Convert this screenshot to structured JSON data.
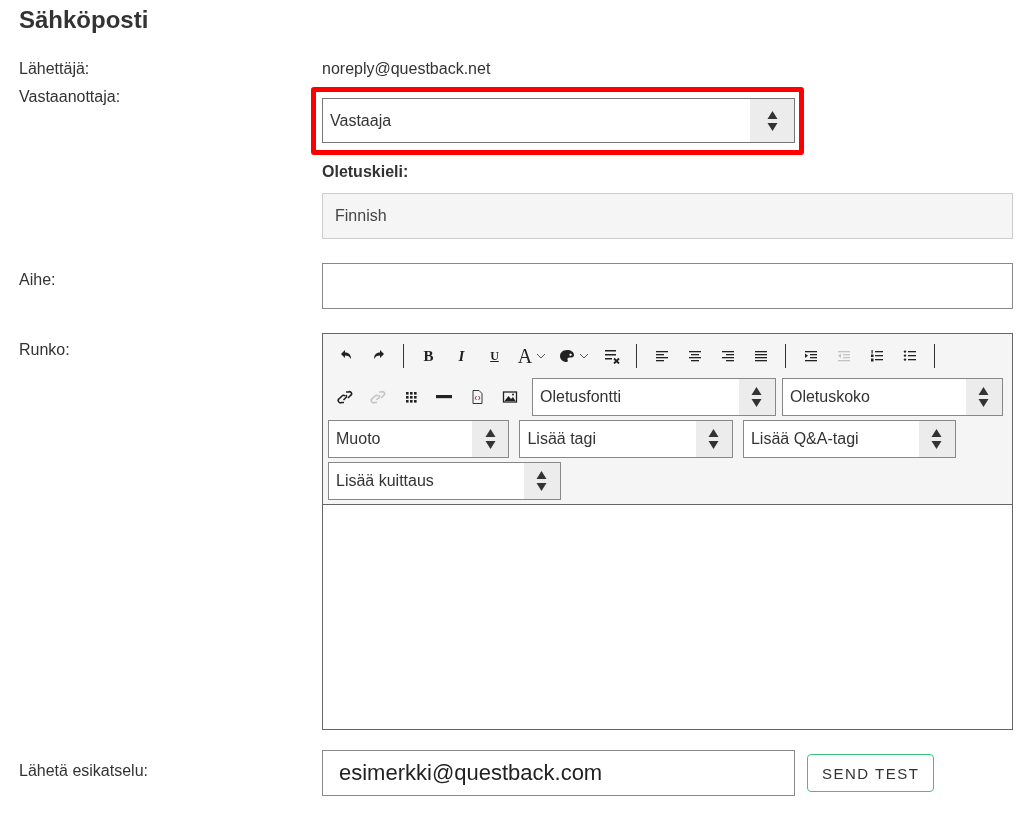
{
  "title": "Sähköposti",
  "sender": {
    "label": "Lähettäjä:",
    "value": "noreply@questback.net"
  },
  "recipient": {
    "label": "Vastaanottaja:",
    "value": "Vastaaja",
    "highlighted": true
  },
  "default_language": {
    "label": "Oletuskieli:",
    "value": "Finnish",
    "disabled": true
  },
  "subject": {
    "label": "Aihe:"
  },
  "body": {
    "label": "Runko:",
    "toolbar": [
      [
        {
          "kind": "undo",
          "disabled": false
        },
        {
          "kind": "redo",
          "disabled": false
        },
        {
          "kind": "separator"
        },
        {
          "kind": "text",
          "label": "B",
          "disabled": false
        },
        {
          "kind": "text",
          "label": "I",
          "disabled": false
        },
        {
          "kind": "text",
          "label": "U",
          "disabled": false
        },
        {
          "kind": "textcolor",
          "label": "A",
          "disabled": false
        },
        {
          "kind": "palette",
          "disabled": false
        },
        {
          "kind": "clearformat",
          "disabled": false
        },
        {
          "kind": "separator"
        },
        {
          "kind": "alignleft",
          "disabled": false
        },
        {
          "kind": "aligncenter",
          "disabled": false
        },
        {
          "kind": "alignright",
          "disabled": false
        },
        {
          "kind": "justify",
          "disabled": false
        },
        {
          "kind": "separator"
        },
        {
          "kind": "indent",
          "disabled": false
        },
        {
          "kind": "outdent",
          "disabled": true
        },
        {
          "kind": "numlist",
          "disabled": false
        },
        {
          "kind": "bullist",
          "disabled": false
        },
        {
          "kind": "separator"
        }
      ],
      [
        {
          "kind": "link",
          "disabled": false
        },
        {
          "kind": "unlink",
          "disabled": true
        },
        {
          "kind": "table",
          "disabled": false
        },
        {
          "kind": "hr",
          "disabled": false
        },
        {
          "kind": "source",
          "disabled": false
        },
        {
          "kind": "image",
          "disabled": false
        },
        {
          "kind": "select",
          "label": "Oletusfontti"
        },
        {
          "kind": "select",
          "label": "Oletuskoko"
        }
      ],
      [
        {
          "kind": "select",
          "label": "Muoto"
        },
        {
          "kind": "select",
          "label": "Lisää tagi"
        },
        {
          "kind": "select",
          "label": "Lisää Q&A-tagi"
        }
      ],
      [
        {
          "kind": "select",
          "label": "Lisää kuittaus"
        }
      ]
    ]
  },
  "preview": {
    "label": "Lähetä esikatselu:",
    "value": "esimerkki@questback.com",
    "button": "SEND TEST"
  }
}
